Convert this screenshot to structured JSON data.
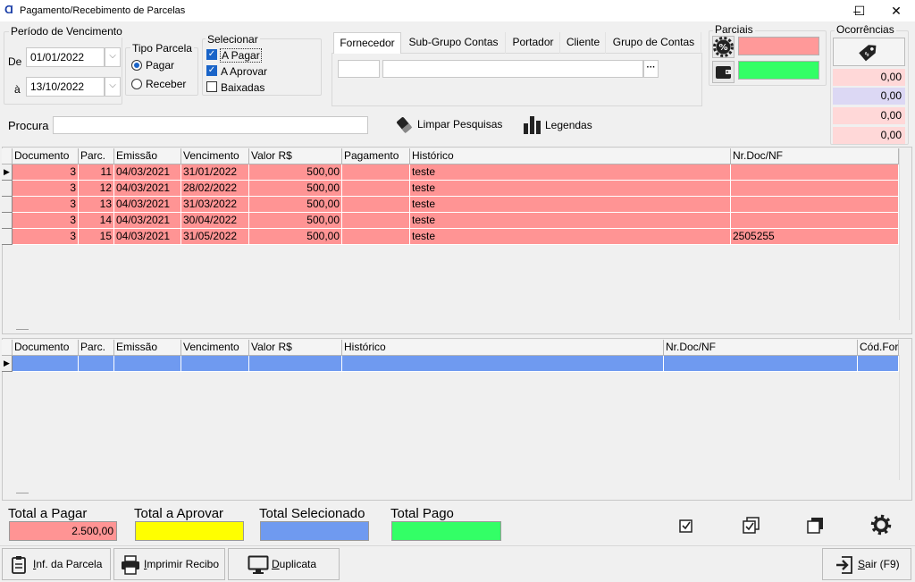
{
  "window": {
    "title": "Pagamento/Recebimento de Parcelas",
    "app_icon": "app-logo-icon",
    "minimize": "–",
    "maximize": "☐",
    "close": "✕"
  },
  "periodo": {
    "legend": "Período de Vencimento",
    "de_label": "De",
    "de_value": "01/01/2022",
    "a_label": "à",
    "a_value": "13/10/2022",
    "dropdown_glyph": "⌵"
  },
  "tipo_parcela": {
    "legend": "Tipo Parcela",
    "pagar": "Pagar",
    "receber": "Receber",
    "selected": "Pagar"
  },
  "selecionar": {
    "legend": "Selecionar",
    "a_pagar": "A Pagar",
    "a_aprovar": "A Aprovar",
    "baixadas": "Baixadas",
    "checked": [
      "A Pagar",
      "A Aprovar"
    ]
  },
  "tabs": {
    "items": [
      "Fornecedor",
      "Sub-Grupo Contas",
      "Portador",
      "Cliente",
      "Grupo de Contas"
    ],
    "active": "Fornecedor",
    "code_value": "",
    "name_value": "",
    "ellipsis": "···"
  },
  "parciais": {
    "legend": "Parciais",
    "color_top": "#ff9999",
    "color_bottom": "#33ff66"
  },
  "ocorrencias": {
    "legend": "Ocorrências",
    "values": [
      "0,00",
      "0,00",
      "0,00",
      "0,00"
    ],
    "colors": [
      "#ffd8d8",
      "#dcd8f4",
      "#ffd8d8",
      "#ffd8d8"
    ]
  },
  "search": {
    "label": "Procura",
    "value": "",
    "limpar": "Limpar Pesquisas",
    "legendas": "Legendas"
  },
  "grid1": {
    "columns": [
      "Documento",
      "Parc.",
      "Emissão",
      "Vencimento",
      "Valor R$",
      "Pagamento",
      "Histórico",
      "Nr.Doc/NF"
    ],
    "rows": [
      [
        "3",
        "11",
        "04/03/2021",
        "31/01/2022",
        "500,00",
        "",
        "teste",
        ""
      ],
      [
        "3",
        "12",
        "04/03/2021",
        "28/02/2022",
        "500,00",
        "",
        "teste",
        ""
      ],
      [
        "3",
        "13",
        "04/03/2021",
        "31/03/2022",
        "500,00",
        "",
        "teste",
        ""
      ],
      [
        "3",
        "14",
        "04/03/2021",
        "30/04/2022",
        "500,00",
        "",
        "teste",
        ""
      ],
      [
        "3",
        "15",
        "04/03/2021",
        "31/05/2022",
        "500,00",
        "",
        "teste",
        "2505255"
      ]
    ],
    "row_color": "#ff9494",
    "row_indicator": "▶"
  },
  "grid2": {
    "columns": [
      "Documento",
      "Parc.",
      "Emissão",
      "Vencimento",
      "Valor R$",
      "Histórico",
      "Nr.Doc/NF",
      "Cód.For"
    ],
    "row_color": "#6f9af0",
    "row_indicator": "▶"
  },
  "totals": {
    "a_pagar_label": "Total a Pagar",
    "a_pagar_value": "2.500,00",
    "a_pagar_color": "#ff9494",
    "a_aprovar_label": "Total a Aprovar",
    "a_aprovar_value": "",
    "a_aprovar_color": "#ffff00",
    "selecionado_label": "Total Selecionado",
    "selecionado_value": "",
    "selecionado_color": "#6f9af0",
    "pago_label": "Total Pago",
    "pago_value": "",
    "pago_color": "#33ff66"
  },
  "toolbar_icons": [
    "check-box-icon",
    "check-all-icon",
    "uncheck-all-icon",
    "gear-icon"
  ],
  "buttons": {
    "inf_parcela": "Inf. da Parcela",
    "imprimir": "Imprimir Recibo",
    "duplicata": "Duplicata",
    "sair": "Sair (F9)"
  }
}
